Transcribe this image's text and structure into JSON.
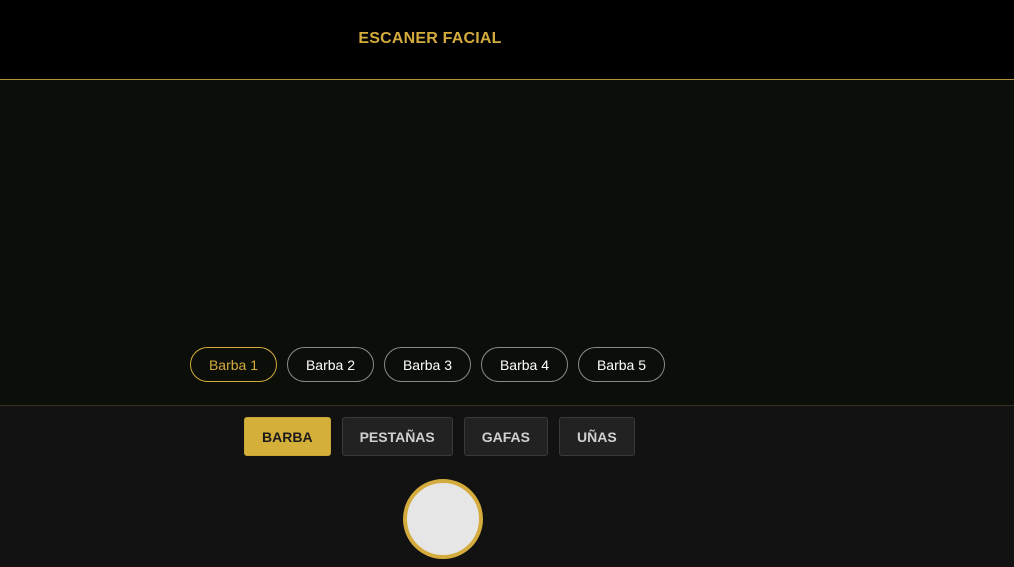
{
  "header": {
    "title": "ESCANER FACIAL"
  },
  "variants": {
    "items": [
      "Barba 1",
      "Barba 2",
      "Barba 3",
      "Barba 4",
      "Barba 5"
    ],
    "selected_index": 0
  },
  "categories": {
    "items": [
      "BARBA",
      "PESTAÑAS",
      "GAFAS",
      "UÑAS"
    ],
    "selected_index": 0
  },
  "colors": {
    "accent": "#d4ab3d",
    "header_bg": "#000000",
    "camera_bg": "#0b0e09",
    "panel_bg": "#121212",
    "shutter_fill": "#e6e6e6"
  },
  "icons": {
    "shutter": "capture-button-circle"
  }
}
